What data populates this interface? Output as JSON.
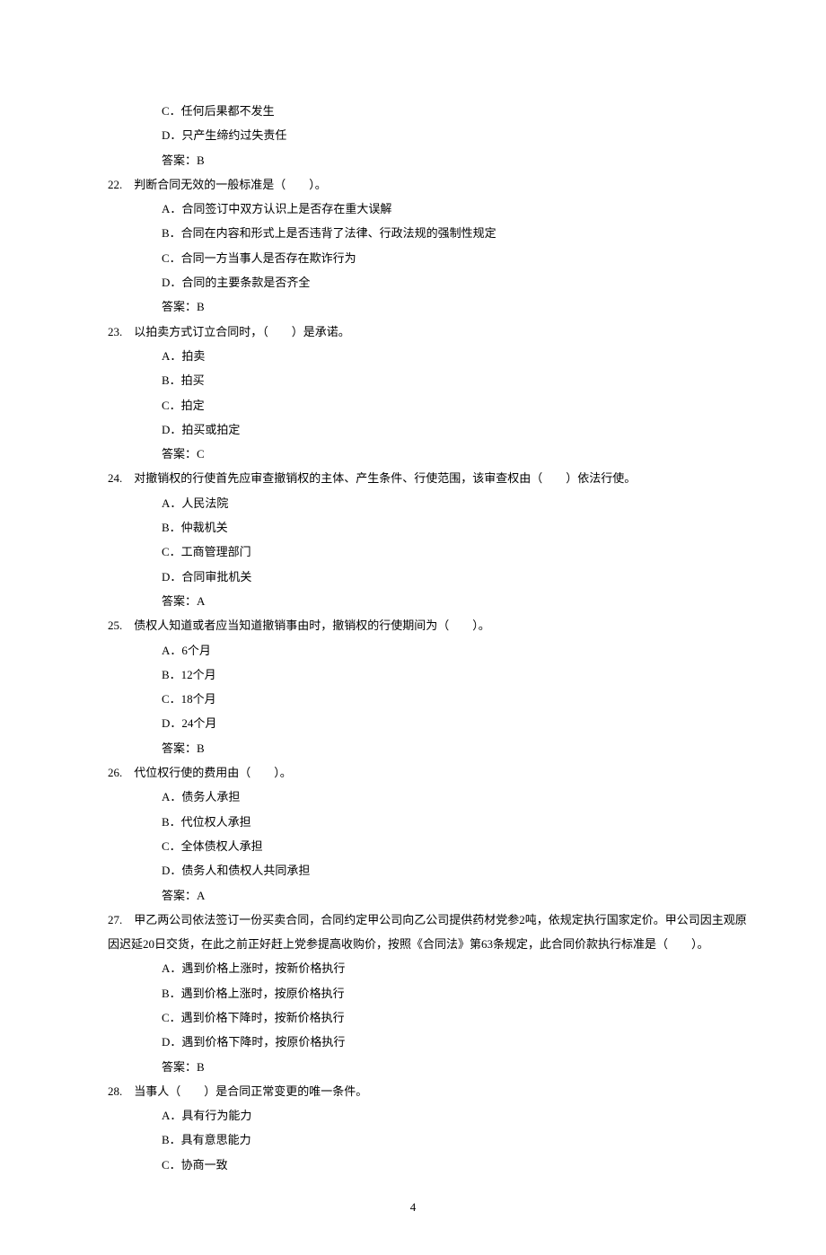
{
  "partial21": {
    "opts": [
      "C．任何后果都不发生",
      "D．只产生缔约过失责任"
    ],
    "answer": "答案：B"
  },
  "q22": {
    "stem": "22.　判断合同无效的一般标准是（　　）。",
    "opts": [
      "A．合同签订中双方认识上是否存在重大误解",
      "B．合同在内容和形式上是否违背了法律、行政法规的强制性规定",
      "C．合同一方当事人是否存在欺诈行为",
      "D．合同的主要条款是否齐全"
    ],
    "answer": "答案：B"
  },
  "q23": {
    "stem": "23.　以拍卖方式订立合同时，（　　）是承诺。",
    "opts": [
      "A．拍卖",
      "B．拍买",
      "C．拍定",
      "D．拍买或拍定"
    ],
    "answer": "答案：C"
  },
  "q24": {
    "stem": "24.　对撤销权的行使首先应审查撤销权的主体、产生条件、行使范围，该审查权由（　　）依法行使。",
    "opts": [
      "A．人民法院",
      "B．仲裁机关",
      "C．工商管理部门",
      "D．合同审批机关"
    ],
    "answer": "答案：A"
  },
  "q25": {
    "stem": "25.　债权人知道或者应当知道撤销事由时，撤销权的行使期间为（　　）。",
    "opts": [
      "A．6个月",
      "B．12个月",
      "C．18个月",
      "D．24个月"
    ],
    "answer": "答案：B"
  },
  "q26": {
    "stem": "26.　代位权行使的费用由（　　）。",
    "opts": [
      "A．债务人承担",
      "B．代位权人承担",
      "C．全体债权人承担",
      "D．债务人和债权人共同承担"
    ],
    "answer": "答案：A"
  },
  "q27": {
    "stem": "27.　甲乙两公司依法签订一份买卖合同，合同约定甲公司向乙公司提供药材党参2吨，依规定执行国家定价。甲公司因主观原",
    "stem2": "因迟延20日交货，在此之前正好赶上党参提高收购价，按照《合同法》第63条规定，此合同价款执行标准是（　　）。",
    "opts": [
      "A．遇到价格上涨时，按新价格执行",
      "B．遇到价格上涨时，按原价格执行",
      "C．遇到价格下降时，按新价格执行",
      "D．遇到价格下降时，按原价格执行"
    ],
    "answer": "答案：B"
  },
  "q28": {
    "stem": "28.　当事人（　　）是合同正常变更的唯一条件。",
    "opts": [
      "A．具有行为能力",
      "B．具有意思能力",
      "C．协商一致"
    ]
  },
  "pageNumber": "4"
}
